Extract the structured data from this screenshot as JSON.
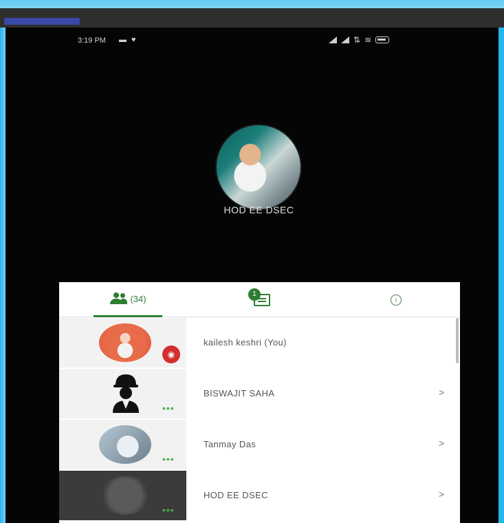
{
  "status_bar": {
    "time": "3:19 PM",
    "left_icons": "▬ ♥",
    "right_icons": [
      "signal-icon",
      "signal-icon",
      "data-icon",
      "wifi-icon",
      "battery-icon"
    ]
  },
  "speaker": {
    "name": "HOD EE DSEC"
  },
  "tabs": {
    "participants_label": "(34)",
    "chat_badge": "1",
    "info_symbol": "i"
  },
  "participants": [
    {
      "name": "kailesh keshri (You)",
      "arrow": "",
      "badge": "◉",
      "dots": ""
    },
    {
      "name": "BISWAJIT SAHA",
      "arrow": ">",
      "badge": "",
      "dots": "•••"
    },
    {
      "name": "Tanmay Das",
      "arrow": ">",
      "badge": "",
      "dots": "•••"
    },
    {
      "name": "HOD EE DSEC",
      "arrow": ">",
      "badge": "",
      "dots": "•••"
    }
  ],
  "colors": {
    "accent_green": "#2e7d32",
    "record_red": "#d32f2f",
    "page_blue": "#27b4ee"
  }
}
